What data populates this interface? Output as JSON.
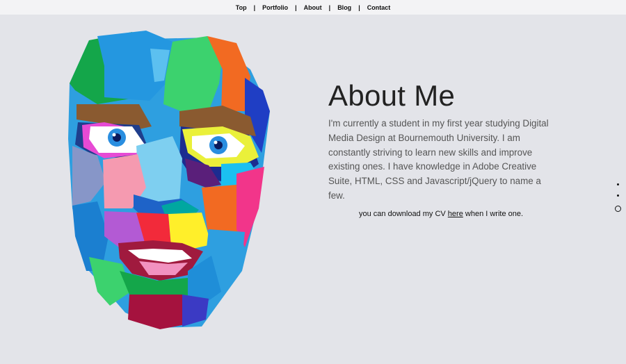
{
  "nav": {
    "items": [
      {
        "label": "Top"
      },
      {
        "label": "Portfolio"
      },
      {
        "label": "About"
      },
      {
        "label": "Blog"
      },
      {
        "label": "Contact"
      }
    ],
    "separator": "|"
  },
  "about": {
    "title": "About Me",
    "description": "I'm currently a student in my first year studying Digital Media Design at Bournemouth University. I am constantly striving to learn new skills and improve existing ones. I have knowledge in Adobe Creative Suite, HTML, CSS and Javascript/jQuery to name a few.",
    "cv_prefix": "you can download my CV ",
    "cv_link": "here",
    "cv_suffix": " when I write one."
  },
  "page_dots": {
    "count": 3,
    "active_index": 2
  },
  "colors": {
    "background": "#e3e4e9",
    "nav_background": "#f3f3f5"
  }
}
